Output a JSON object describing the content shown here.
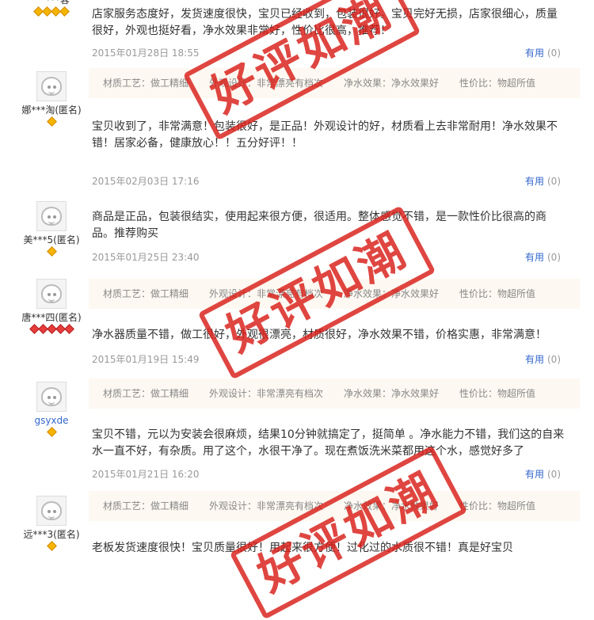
{
  "top": {
    "user_fragment": "一 ***蓉",
    "content": "店家服务态度好，发货速度很快，宝贝已经收到，包装很好。宝贝完好无损，店家很细心，质量很好，外观也挺好看，净水效果非常好，性价比很高，推荐！",
    "date": "2015年01月28日 18:55",
    "useful_label": "有用",
    "useful_count": "(0)"
  },
  "reviews": [
    {
      "user": "娜***淘(匿名)",
      "tags": [
        "材质工艺：做工精细",
        "外观设计：非常漂亮有档次",
        "净水效果：净水效果好",
        "性价比：物超所值"
      ],
      "content": "宝贝收到了，非常满意！包装很好，是正品！外观设计的好，材质看上去非常耐用！净水效果不错！居家必备，健康放心！！五分好评！！",
      "date": "2015年02月03日 17:16",
      "useful_label": "有用",
      "useful_count": "(0)"
    },
    {
      "user": "美***5(匿名)",
      "tags": [],
      "content": "商品是正品，包装很结实，使用起来很方便，很适用。整体感觉不错，是一款性价比很高的商品。推荐购买",
      "date": "2015年01月25日 23:40",
      "useful_label": "有用",
      "useful_count": "(0)"
    },
    {
      "user": "唐***四(匿名)",
      "tags": [
        "材质工艺：做工精细",
        "外观设计：非常漂亮有档次",
        "净水效果：净水效果好",
        "性价比：物超所值"
      ],
      "content": "净水器质量不错，做工很好，外观很漂亮，材质很好，净水效果不错，价格实惠，非常满意！",
      "date": "2015年01月19日 15:49",
      "useful_label": "有用",
      "useful_count": "(0)"
    },
    {
      "user": "gsyxde",
      "tags": [
        "材质工艺：做工精细",
        "外观设计：非常漂亮有档次",
        "净水效果：净水效果好",
        "性价比：物超所值"
      ],
      "content": "宝贝不错，元以为安装会很麻烦，结果10分钟就搞定了，挺简单 。净水能力不错，我们这的自来水一直不好，有杂质。用了这个，水很干净了。现在煮饭洗米菜都用这个水，感觉好多了",
      "date": "2015年01月21日 16:20",
      "useful_label": "有用",
      "useful_count": "(0)"
    },
    {
      "user": "远***3(匿名)",
      "tags": [
        "材质工艺：做工精细",
        "外观设计：非常漂亮有档次",
        "净水效果：净水效果好",
        "性价比：物超所值"
      ],
      "content": "老板发货速度很快！宝贝质量很好！用起来很方便！过化过的水质很不错！真是好宝贝",
      "date": "",
      "useful_label": "",
      "useful_count": ""
    }
  ],
  "stamp_text": "好评如潮",
  "colors": {
    "stamp": "#d91e18",
    "link": "#3366cc",
    "tag_bg": "#fdf8f1"
  },
  "icons": {
    "avatar": "default-avatar-icon",
    "rank": "diamond-rank-icon"
  }
}
